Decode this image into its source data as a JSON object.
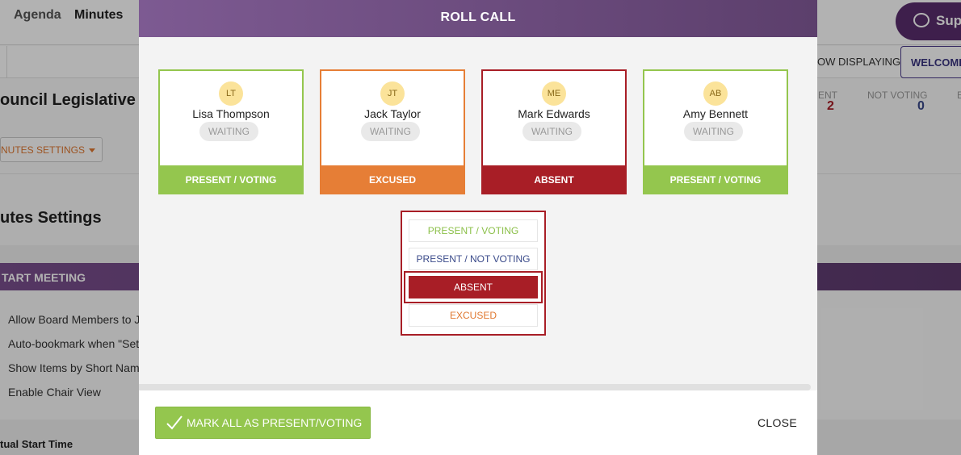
{
  "background": {
    "support_label": "Supp",
    "tabs": {
      "agenda": "Agenda",
      "minutes": "Minutes"
    },
    "now_displaying_label": "OW DISPLAYING:",
    "welcome_label": "WELCOME",
    "meeting_title": "ouncil Legislative Se",
    "stats": {
      "present_label": "ENT",
      "present_value": "2",
      "not_voting_label": "NOT VOTING",
      "not_voting_value": "0",
      "extra_label": "E"
    },
    "minutes_settings_button": "NUTES SETTINGS",
    "section_title": "utes Settings",
    "start_meeting_bar": "TART MEETING",
    "options": [
      "Allow Board Members to J",
      "Auto-bookmark when \"Set",
      "Show Items by Short Name",
      "Enable Chair View"
    ],
    "actual_start_time": "tual Start Time"
  },
  "modal": {
    "title": "ROLL CALL",
    "members": [
      {
        "initials": "LT",
        "name": "Lisa Thompson",
        "status": "WAITING",
        "vote": "PRESENT / VOTING",
        "color": "#94c64e"
      },
      {
        "initials": "JT",
        "name": "Jack Taylor",
        "status": "WAITING",
        "vote": "EXCUSED",
        "color": "#e67e36"
      },
      {
        "initials": "ME",
        "name": "Mark Edwards",
        "status": "WAITING",
        "vote": "ABSENT",
        "color": "#a81e26"
      },
      {
        "initials": "AB",
        "name": "Amy Bennett",
        "status": "WAITING",
        "vote": "PRESENT / VOTING",
        "color": "#94c64e"
      }
    ],
    "dropdown": {
      "options": [
        {
          "label": "PRESENT / VOTING",
          "color": "#8cc04a"
        },
        {
          "label": "PRESENT / NOT VOTING",
          "color": "#3a4a8a"
        },
        {
          "label": "ABSENT",
          "color": "#ffffff"
        },
        {
          "label": "EXCUSED",
          "color": "#e07830"
        }
      ],
      "selected": "ABSENT"
    },
    "footer": {
      "mark_all_label": "MARK ALL AS PRESENT/VOTING",
      "close_label": "CLOSE"
    }
  }
}
